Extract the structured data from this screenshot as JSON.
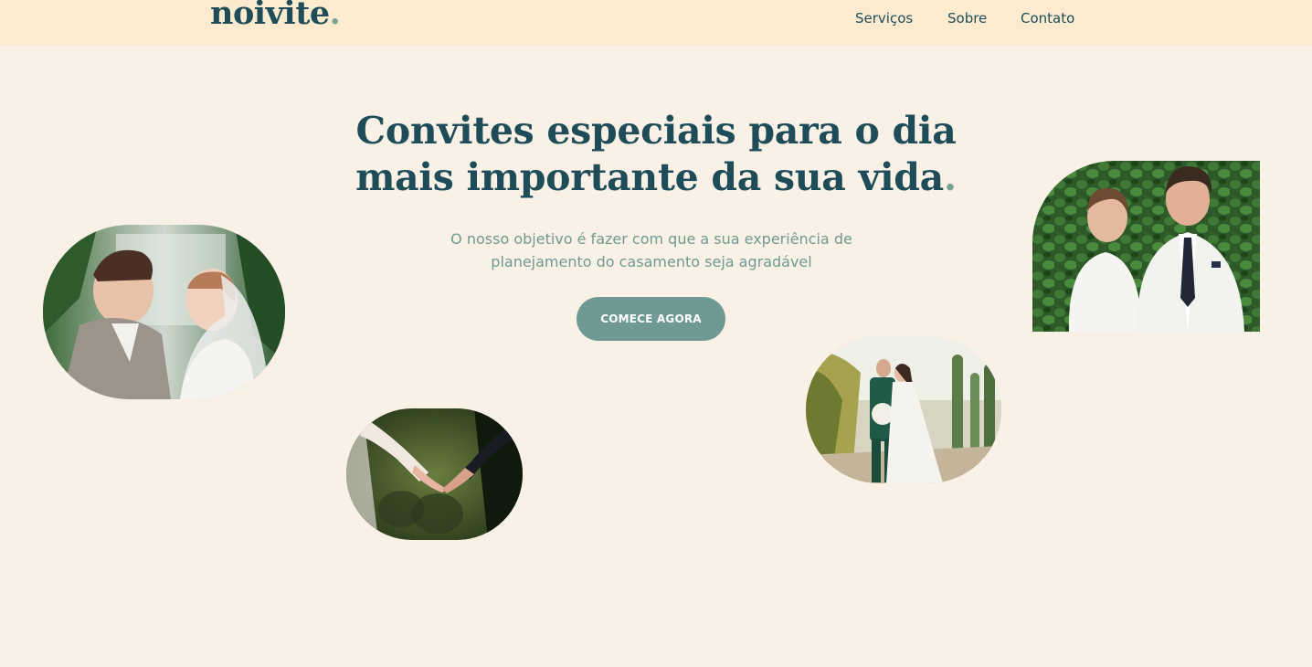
{
  "header": {
    "logo_text": "noivite",
    "logo_dot": ".",
    "nav": [
      "Serviços",
      "Sobre",
      "Contato"
    ]
  },
  "hero": {
    "title_line1": "Convites especiais para o dia",
    "title_line2": "mais importante da sua vida",
    "title_dot": ".",
    "subtitle": "O nosso objetivo é fazer com que a sua experiência de planejamento do casamento seja agradável",
    "cta_label": "COMECE AGORA"
  },
  "colors": {
    "background": "#faf1e6",
    "header_background": "#fdebd0",
    "primary_text": "#1e4d59",
    "accent": "#7aa294",
    "button": "#6e9a93"
  },
  "photos": [
    {
      "name": "couple-greenhouse-photo"
    },
    {
      "name": "holding-hands-photo"
    },
    {
      "name": "couple-desert-photo"
    },
    {
      "name": "couple-ivy-wall-photo"
    }
  ]
}
